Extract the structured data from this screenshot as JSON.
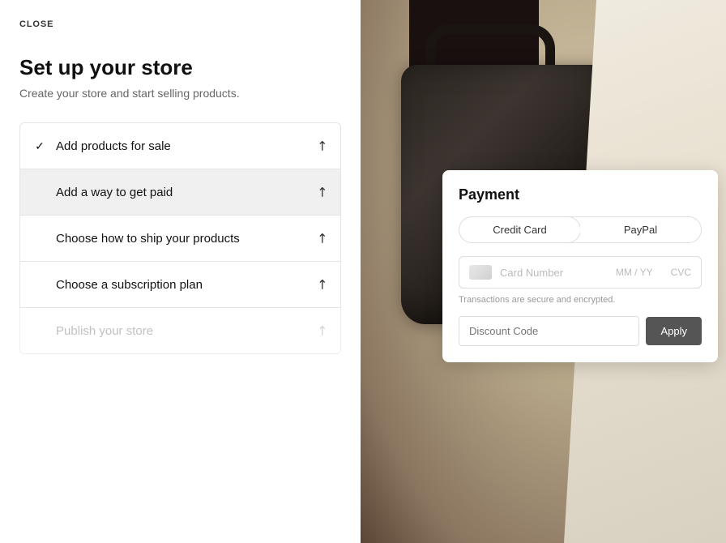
{
  "close_label": "CLOSE",
  "header": {
    "title": "Set up your store",
    "subtitle": "Create your store and start selling products."
  },
  "steps": [
    {
      "id": "add-products",
      "label": "Add products for sale",
      "completed": true,
      "active": false,
      "disabled": false,
      "check": "✓",
      "arrow": "↗"
    },
    {
      "id": "add-payment",
      "label": "Add a way to get paid",
      "completed": false,
      "active": true,
      "disabled": false,
      "check": "",
      "arrow": "↗"
    },
    {
      "id": "shipping",
      "label": "Choose how to ship your products",
      "completed": false,
      "active": false,
      "disabled": false,
      "check": "",
      "arrow": "↗"
    },
    {
      "id": "subscription",
      "label": "Choose a subscription plan",
      "completed": false,
      "active": false,
      "disabled": false,
      "check": "",
      "arrow": "↗"
    },
    {
      "id": "publish",
      "label": "Publish your store",
      "completed": false,
      "active": false,
      "disabled": true,
      "check": "",
      "arrow": "↗"
    }
  ],
  "payment_card": {
    "title": "Payment",
    "tab_credit": "Credit Card",
    "tab_paypal": "PayPal",
    "card_number_placeholder": "Card Number",
    "expiry_placeholder": "MM / YY",
    "cvc_placeholder": "CVC",
    "secure_text": "Transactions are secure and encrypted.",
    "discount_placeholder": "Discount Code",
    "apply_label": "Apply"
  }
}
